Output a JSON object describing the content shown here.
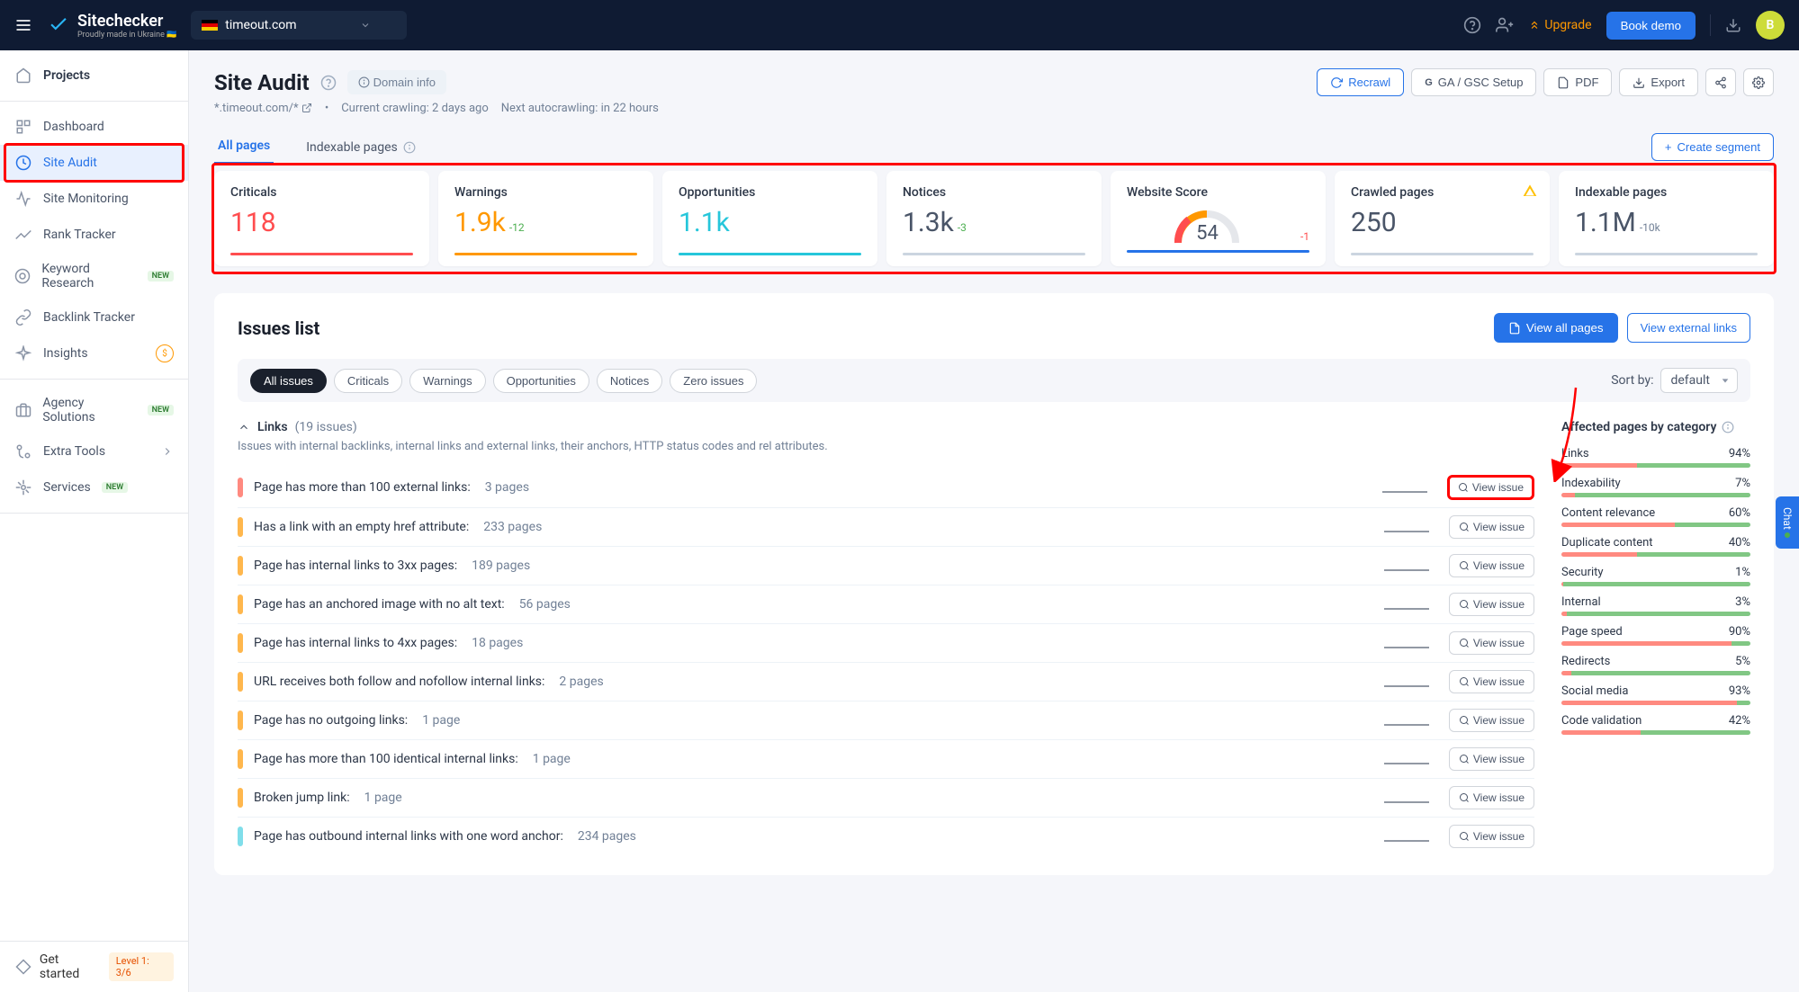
{
  "brand": {
    "name": "Sitechecker",
    "tagline": "Proudly made in Ukraine 🇺🇦"
  },
  "domain_selector": {
    "domain": "timeout.com"
  },
  "topnav": {
    "upgrade": "Upgrade",
    "book_demo": "Book demo",
    "avatar_initial": "B"
  },
  "sidebar": {
    "projects": "Projects",
    "items": [
      {
        "label": "Dashboard"
      },
      {
        "label": "Site Audit"
      },
      {
        "label": "Site Monitoring"
      },
      {
        "label": "Rank Tracker"
      },
      {
        "label": "Keyword Research",
        "new": true
      },
      {
        "label": "Backlink Tracker"
      },
      {
        "label": "Insights"
      }
    ],
    "secondary": [
      {
        "label": "Agency Solutions",
        "new": true
      },
      {
        "label": "Extra Tools",
        "chevron": true
      },
      {
        "label": "Services",
        "new": true
      }
    ],
    "get_started": "Get started",
    "level": "Level 1: 3/6"
  },
  "page": {
    "title": "Site Audit",
    "domain_info": "Domain info",
    "scope": "*.timeout.com/*",
    "crawl_status": "Current crawling: 2 days ago",
    "next_crawl": "Next autocrawling: in 22 hours",
    "actions": {
      "recrawl": "Recrawl",
      "ga_gsc": "GA / GSC Setup",
      "pdf": "PDF",
      "export": "Export"
    }
  },
  "tabs": {
    "all_pages": "All pages",
    "indexable": "Indexable pages",
    "create_segment": "Create segment"
  },
  "stats": {
    "criticals": {
      "label": "Criticals",
      "value": "118"
    },
    "warnings": {
      "label": "Warnings",
      "value": "1.9k",
      "delta": "-12"
    },
    "opportunities": {
      "label": "Opportunities",
      "value": "1.1k"
    },
    "notices": {
      "label": "Notices",
      "value": "1.3k",
      "delta": "-3"
    },
    "score": {
      "label": "Website Score",
      "value": "54",
      "delta": "-1"
    },
    "crawled": {
      "label": "Crawled pages",
      "value": "250"
    },
    "indexable": {
      "label": "Indexable pages",
      "value": "1.1M",
      "delta": "-10k"
    }
  },
  "issues": {
    "title": "Issues list",
    "view_all": "View all pages",
    "view_external": "View external links",
    "filters": {
      "all": "All issues",
      "criticals": "Criticals",
      "warnings": "Warnings",
      "opportunities": "Opportunities",
      "notices": "Notices",
      "zero": "Zero issues"
    },
    "sort_label": "Sort by:",
    "sort_value": "default",
    "group": {
      "name": "Links",
      "count": "(19 issues)",
      "desc": "Issues with internal backlinks, internal links and external links, their anchors, HTTP status codes and rel attributes."
    },
    "rows": [
      {
        "sev": "sev-red",
        "text": "Page has more than 100 external links:",
        "count": "3 pages"
      },
      {
        "sev": "sev-orange",
        "text": "Has a link with an empty href attribute:",
        "count": "233 pages"
      },
      {
        "sev": "sev-orange",
        "text": "Page has internal links to 3xx pages:",
        "count": "189 pages"
      },
      {
        "sev": "sev-orange",
        "text": "Page has an anchored image with no alt text:",
        "count": "56 pages"
      },
      {
        "sev": "sev-orange",
        "text": "Page has internal links to 4xx pages:",
        "count": "18 pages"
      },
      {
        "sev": "sev-orange",
        "text": "URL receives both follow and nofollow internal links:",
        "count": "2 pages"
      },
      {
        "sev": "sev-orange",
        "text": "Page has no outgoing links:",
        "count": "1 page"
      },
      {
        "sev": "sev-orange",
        "text": "Page has more than 100 identical internal links:",
        "count": "1 page"
      },
      {
        "sev": "sev-orange",
        "text": "Broken jump link:",
        "count": "1 page"
      },
      {
        "sev": "sev-cyan",
        "text": "Page has outbound internal links with one word anchor:",
        "count": "234 pages"
      }
    ],
    "view_issue": "View issue"
  },
  "categories": {
    "title": "Affected pages by category",
    "items": [
      {
        "name": "Links",
        "pct": "94%",
        "red": 40,
        "green": 60
      },
      {
        "name": "Indexability",
        "pct": "7%",
        "red": 7,
        "green": 93
      },
      {
        "name": "Content relevance",
        "pct": "60%",
        "red": 60,
        "green": 40
      },
      {
        "name": "Duplicate content",
        "pct": "40%",
        "red": 40,
        "green": 60
      },
      {
        "name": "Security",
        "pct": "1%",
        "red": 1,
        "green": 99
      },
      {
        "name": "Internal",
        "pct": "3%",
        "red": 3,
        "green": 97
      },
      {
        "name": "Page speed",
        "pct": "90%",
        "red": 90,
        "green": 10
      },
      {
        "name": "Redirects",
        "pct": "5%",
        "red": 5,
        "green": 95
      },
      {
        "name": "Social media",
        "pct": "93%",
        "red": 93,
        "green": 7
      },
      {
        "name": "Code validation",
        "pct": "42%",
        "red": 42,
        "green": 58
      }
    ]
  },
  "chat": "Chat"
}
